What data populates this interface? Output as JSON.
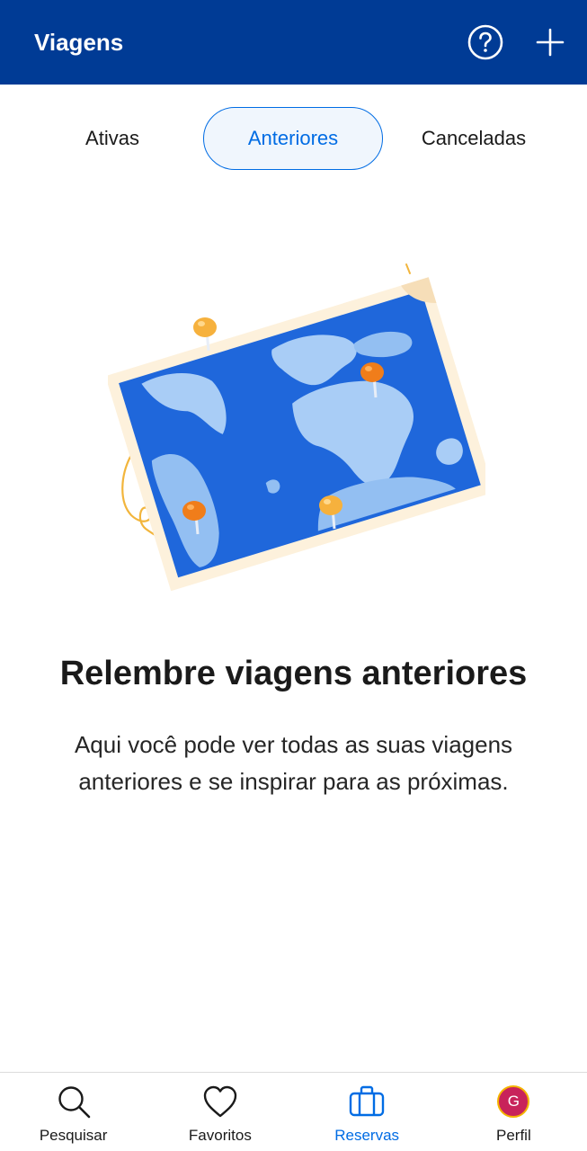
{
  "header": {
    "title": "Viagens",
    "help_icon": "question-circle-icon",
    "add_icon": "plus-icon"
  },
  "tabs": [
    {
      "label": "Ativas",
      "active": false
    },
    {
      "label": "Anteriores",
      "active": true
    },
    {
      "label": "Canceladas",
      "active": false
    }
  ],
  "empty_state": {
    "illustration": "world-map-with-pins",
    "title": "Relembre viagens anteriores",
    "description": "Aqui você pode ver todas as suas viagens anteriores e se inspirar para as próximas."
  },
  "bottom_nav": {
    "items": [
      {
        "label": "Pesquisar",
        "icon": "search-icon",
        "active": false
      },
      {
        "label": "Favoritos",
        "icon": "heart-icon",
        "active": false
      },
      {
        "label": "Reservas",
        "icon": "suitcase-icon",
        "active": true
      },
      {
        "label": "Perfil",
        "icon": "avatar",
        "active": false
      }
    ],
    "avatar_initial": "G"
  },
  "colors": {
    "brand": "#003b95",
    "accent": "#006ce4",
    "avatar_bg": "#c8235a",
    "avatar_ring": "#f4b400"
  }
}
